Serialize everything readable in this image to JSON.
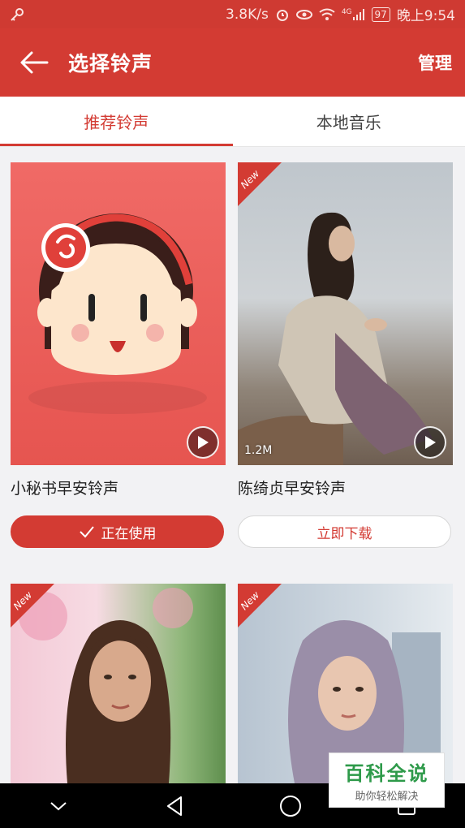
{
  "status_bar": {
    "speed": "3.8K/s",
    "network": "4G",
    "battery": "97",
    "time": "晚上9:54"
  },
  "app_bar": {
    "title": "选择铃声",
    "manage_label": "管理"
  },
  "tabs": [
    {
      "label": "推荐铃声",
      "active": true
    },
    {
      "label": "本地音乐",
      "active": false
    }
  ],
  "ringtones": [
    {
      "title": "小秘书早安铃声",
      "button_label": "正在使用",
      "state": "using",
      "is_new": false,
      "size": ""
    },
    {
      "title": "陈绮贞早安铃声",
      "button_label": "立即下载",
      "state": "download",
      "is_new": true,
      "new_label": "New",
      "size": "1.2M"
    },
    {
      "title": "",
      "is_new": true,
      "new_label": "New"
    },
    {
      "title": "",
      "is_new": true,
      "new_label": "New"
    }
  ],
  "watermark": {
    "title": "百科全说",
    "subtitle": "助你轻松解决"
  },
  "colors": {
    "accent": "#d33b33",
    "background": "#f2f2f4"
  }
}
